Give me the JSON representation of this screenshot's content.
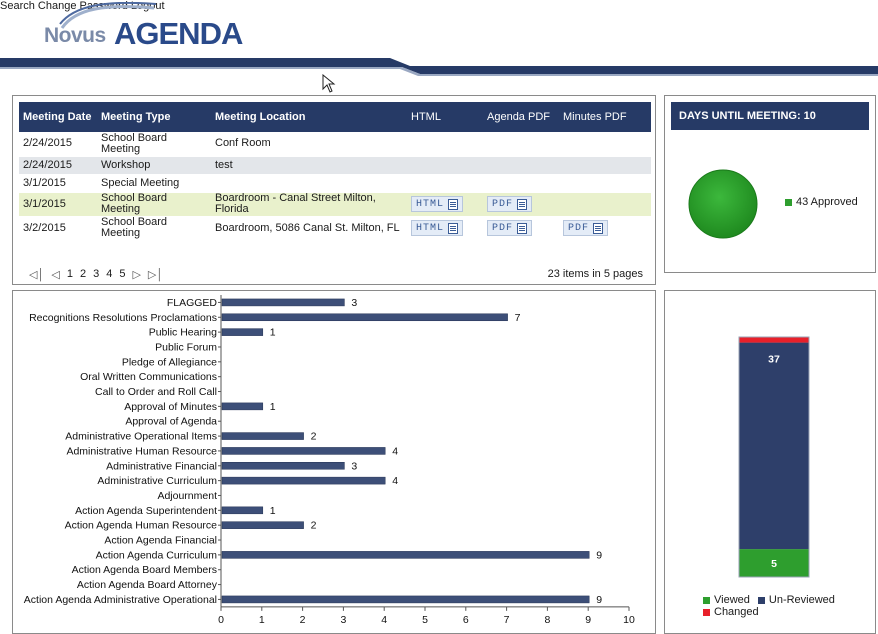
{
  "header": {
    "logo": {
      "word1": "Novus",
      "word2": "AGENDA"
    },
    "nav": [
      {
        "label": "Search"
      },
      {
        "label": "Change Password"
      },
      {
        "label": "Logout"
      }
    ],
    "colors": {
      "brand_dark": "#263a66",
      "brand_mid": "#2a4a8a",
      "brand_light": "#7a8aa8"
    }
  },
  "meetings": {
    "columns": [
      "Meeting Date",
      "Meeting Type",
      "Meeting Location",
      "HTML",
      "Agenda PDF",
      "Minutes PDF"
    ],
    "rows": [
      {
        "date": "2/24/2015",
        "type": "School Board Meeting",
        "location": "Conf Room",
        "html": "",
        "agenda_pdf": "",
        "minutes_pdf": ""
      },
      {
        "date": "2/24/2015",
        "type": "Workshop",
        "location": "test",
        "html": "",
        "agenda_pdf": "",
        "minutes_pdf": ""
      },
      {
        "date": "3/1/2015",
        "type": "Special Meeting",
        "location": "",
        "html": "",
        "agenda_pdf": "",
        "minutes_pdf": ""
      },
      {
        "date": "3/1/2015",
        "type": "School Board Meeting",
        "location": "Boardroom - Canal Street Milton, Florida",
        "html": "HTML",
        "agenda_pdf": "PDF",
        "minutes_pdf": ""
      },
      {
        "date": "3/2/2015",
        "type": "School Board Meeting",
        "location": "Boardroom, 5086 Canal St. Milton, FL",
        "html": "HTML",
        "agenda_pdf": "PDF",
        "minutes_pdf": "PDF"
      }
    ],
    "pager": {
      "pages": [
        "1",
        "2",
        "3",
        "4",
        "5"
      ],
      "summary": "23 items in 5 pages"
    },
    "colors": {
      "highlight_row": "#e9f1cc",
      "alt_row": "#e3e6ea"
    }
  },
  "days_panel": {
    "title": "DAYS UNTIL MEETING: 10",
    "legend": "43 Approved",
    "color": "#2e9e2e"
  },
  "chart_data": [
    {
      "type": "bar",
      "orientation": "horizontal",
      "categories": [
        "FLAGGED",
        "Recognitions Resolutions Proclamations",
        "Public Hearing",
        "Public Forum",
        "Pledge of Allegiance",
        "Oral Written Communications",
        "Call to Order and Roll Call",
        "Approval of Minutes",
        "Approval of Agenda",
        "Administrative Operational Items",
        "Administrative Human Resource",
        "Administrative Financial",
        "Administrative Curriculum",
        "Adjournment",
        "Action Agenda Superintendent",
        "Action Agenda Human Resource",
        "Action Agenda Financial",
        "Action Agenda Curriculum",
        "Action Agenda Board Members",
        "Action Agenda Board Attorney",
        "Action Agenda Administrative Operational"
      ],
      "values": [
        3,
        7,
        1,
        null,
        null,
        null,
        null,
        1,
        null,
        2,
        4,
        3,
        4,
        null,
        1,
        2,
        null,
        9,
        null,
        null,
        9
      ],
      "xlim": [
        0,
        10
      ],
      "xticks": [
        "0",
        "1",
        "2",
        "3",
        "4",
        "5",
        "6",
        "7",
        "8",
        "9",
        "10"
      ],
      "bar_color": "#3d4f78"
    },
    {
      "type": "bar",
      "stacked": true,
      "series": [
        {
          "name": "Viewed",
          "values": [
            5
          ],
          "color": "#2e9e2e"
        },
        {
          "name": "Un-Reviewed",
          "values": [
            37
          ],
          "color": "#2e3f6a"
        },
        {
          "name": "Changed",
          "values": [
            1
          ],
          "color": "#e8202a"
        }
      ],
      "legend_placement": "bottom"
    }
  ]
}
